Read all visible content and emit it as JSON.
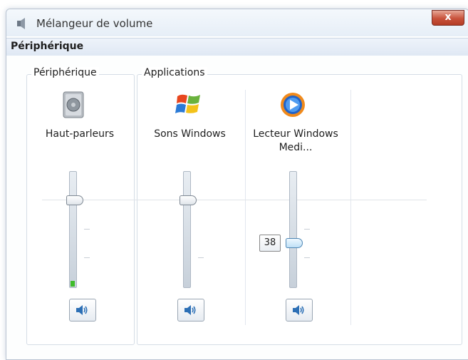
{
  "window": {
    "title": "Mélangeur de volume",
    "close_label": "x"
  },
  "menubar": {
    "items": [
      {
        "label": "Périphérique"
      }
    ]
  },
  "groups": {
    "device": {
      "label": "Périphérique",
      "channels": [
        {
          "label": "Haut-parleurs",
          "icon": "speaker-device-icon",
          "volume_fraction": 0.75,
          "peak_fraction": 0.05
        }
      ]
    },
    "applications": {
      "label": "Applications",
      "channels": [
        {
          "label": "Sons Windows",
          "icon": "windows-logo-icon",
          "volume_fraction": 0.75
        },
        {
          "label": "Lecteur Windows Medi...",
          "icon": "windows-media-player-icon",
          "volume_fraction": 0.38,
          "tooltip": "38"
        }
      ]
    }
  },
  "colors": {
    "accent": "#4f87b5",
    "level_meter": "#3fbc2b",
    "close_button": "#c8523b"
  }
}
